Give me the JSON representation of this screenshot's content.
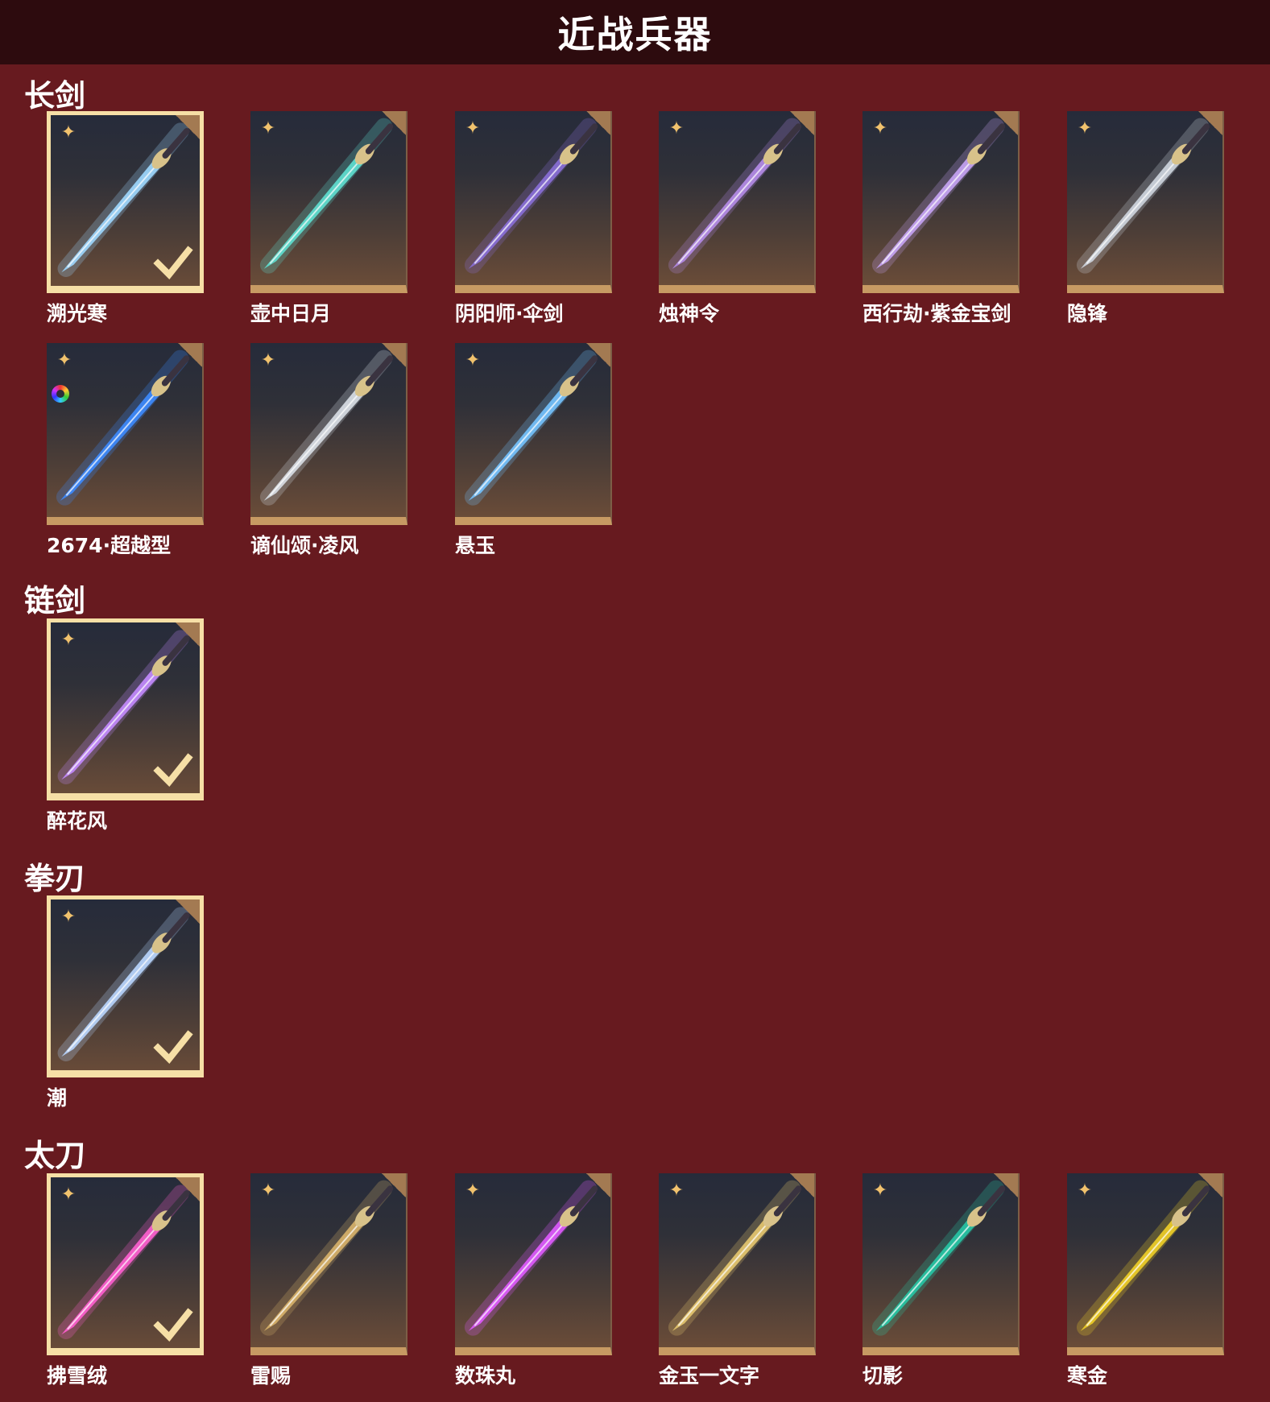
{
  "header": {
    "title": "近战兵器"
  },
  "sections": [
    {
      "title": "长剑",
      "items": [
        {
          "name": "溯光寒",
          "selected": true,
          "accent": "#9fd8ff",
          "icon": "ice-blade-icon"
        },
        {
          "name": "壶中日月",
          "selected": false,
          "accent": "#5fe0d2",
          "icon": "jade-blade-icon"
        },
        {
          "name": "阴阳师·伞剑",
          "selected": false,
          "accent": "#8a6fd8",
          "icon": "umbrella-sword-icon"
        },
        {
          "name": "烛神令",
          "selected": false,
          "accent": "#b58ce8",
          "icon": "dragon-blade-icon"
        },
        {
          "name": "西行劫·紫金宝剑",
          "selected": false,
          "accent": "#c7a4f5",
          "icon": "purple-gold-blade-icon"
        },
        {
          "name": "隐锋",
          "selected": false,
          "accent": "#cfd6e0",
          "icon": "thin-blade-icon"
        },
        {
          "name": "2674·超越型",
          "selected": false,
          "accent": "#3d8bff",
          "icon": "plasma-blade-icon",
          "dye": true
        },
        {
          "name": "谪仙颂·凌风",
          "selected": false,
          "accent": "#d9dfe6",
          "icon": "silver-blade-icon"
        },
        {
          "name": "悬玉",
          "selected": false,
          "accent": "#74c3ff",
          "icon": "crystal-blade-icon"
        }
      ]
    },
    {
      "title": "链剑",
      "items": [
        {
          "name": "醉花风",
          "selected": true,
          "accent": "#c48bff",
          "icon": "chain-sword-icon"
        }
      ]
    },
    {
      "title": "拳刃",
      "items": [
        {
          "name": "潮",
          "selected": true,
          "accent": "#b9d6ff",
          "icon": "claw-blade-icon"
        }
      ]
    },
    {
      "title": "太刀",
      "items": [
        {
          "name": "拂雪绒",
          "selected": true,
          "accent": "#ff5fd0",
          "icon": "pink-katana-icon"
        },
        {
          "name": "雷赐",
          "selected": false,
          "accent": "#d8b36a",
          "icon": "gold-katana-icon"
        },
        {
          "name": "数珠丸",
          "selected": false,
          "accent": "#e05bff",
          "icon": "violet-katana-icon"
        },
        {
          "name": "金玉一文字",
          "selected": false,
          "accent": "#e7c86f",
          "icon": "white-katana-icon"
        },
        {
          "name": "切影",
          "selected": false,
          "accent": "#27c7a5",
          "icon": "teal-katana-icon"
        },
        {
          "name": "寒金",
          "selected": false,
          "accent": "#f0cf27",
          "icon": "yellow-katana-icon"
        }
      ]
    }
  ],
  "colors": {
    "background": "#671a1f",
    "header": "#2d0b0e",
    "selected_border": "#f6dfa6",
    "tile_bottom": "#c79a63",
    "star": "#f1c26d"
  }
}
